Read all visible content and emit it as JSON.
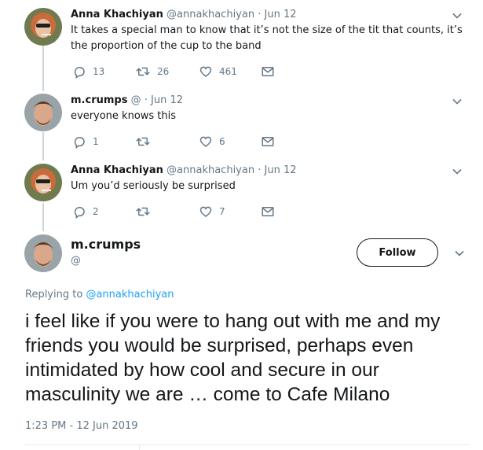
{
  "thread": [
    {
      "name": "Anna Khachiyan",
      "handle": "@annakhachiyan",
      "separator": "·",
      "date": "Jun 12",
      "text": "It takes a special man to know that it’s not the size of the tit that counts, it’s the proportion of the cup to the band",
      "replies": "13",
      "retweets": "26",
      "likes": "461"
    },
    {
      "name": "m.crumps",
      "handle": "@",
      "separator": "·",
      "date": "Jun 12",
      "text": "everyone knows this",
      "replies": "1",
      "retweets": "",
      "likes": "6"
    },
    {
      "name": "Anna Khachiyan",
      "handle": "@annakhachiyan",
      "separator": "·",
      "date": "Jun 12",
      "text": "Um you’d seriously be surprised",
      "replies": "2",
      "retweets": "",
      "likes": "7"
    }
  ],
  "main": {
    "name": "m.crumps",
    "handle": "@",
    "follow_label": "Follow",
    "replying_prefix": "Replying to",
    "replying_to": "@annakhachiyan",
    "text": "i feel like if you were to hang out with me and my friends you would be surprised, perhaps even intimidated by how cool and secure in our masculinity we are … come to Cafe Milano",
    "timestamp": "1:23 PM - 12 Jun 2019"
  },
  "colors": {
    "text": "#14171a",
    "secondary": "#657786",
    "link": "#1da1f2",
    "thread_line": "#ccd6dd"
  },
  "icons": [
    "reply-icon",
    "retweet-icon",
    "like-icon",
    "dm-icon",
    "chevron-down-icon"
  ]
}
